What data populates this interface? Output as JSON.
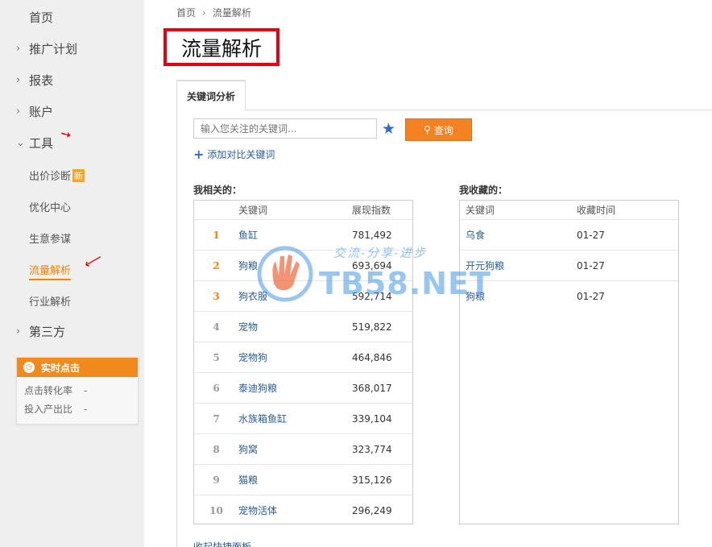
{
  "sidebar": {
    "home": "首页",
    "plan": "推广计划",
    "report": "报表",
    "account": "账户",
    "tools": "工具",
    "tool_items": [
      "出价诊断",
      "优化中心",
      "生意参谋",
      "流量解析",
      "行业解析"
    ],
    "new_badge": "新",
    "third_party": "第三方",
    "realtime": {
      "title": "实时点击",
      "rows": [
        {
          "label": "点击转化率",
          "value": "-"
        },
        {
          "label": "投入产出比",
          "value": "-"
        }
      ]
    }
  },
  "breadcrumb": {
    "home": "首页",
    "current": "流量解析"
  },
  "page_title": "流量解析",
  "tab": "关键词分析",
  "search": {
    "placeholder": "输入您关注的关键词...",
    "button": "查询"
  },
  "add_compare": "添加对比关键词",
  "related": {
    "title": "我相关的：",
    "headers": {
      "keyword": "关键词",
      "index": "展现指数"
    },
    "rows": [
      {
        "rank": "1",
        "keyword": "鱼缸",
        "value": "781,492"
      },
      {
        "rank": "2",
        "keyword": "狗粮",
        "value": "693,694"
      },
      {
        "rank": "3",
        "keyword": "狗衣服",
        "value": "592,714"
      },
      {
        "rank": "4",
        "keyword": "宠物",
        "value": "519,822"
      },
      {
        "rank": "5",
        "keyword": "宠物狗",
        "value": "464,846"
      },
      {
        "rank": "6",
        "keyword": "泰迪狗粮",
        "value": "368,017"
      },
      {
        "rank": "7",
        "keyword": "水族箱鱼缸",
        "value": "339,104"
      },
      {
        "rank": "8",
        "keyword": "狗窝",
        "value": "323,774"
      },
      {
        "rank": "9",
        "keyword": "猫粮",
        "value": "315,126"
      },
      {
        "rank": "10",
        "keyword": "宠物活体",
        "value": "296,249"
      }
    ]
  },
  "favorites": {
    "title": "我收藏的：",
    "headers": {
      "keyword": "关键词",
      "time": "收藏时间"
    },
    "rows": [
      {
        "keyword": "乌食",
        "time": "01-27"
      },
      {
        "keyword": "开元狗粮",
        "time": "01-27"
      },
      {
        "keyword": "狗粮",
        "time": "01-27"
      }
    ]
  },
  "bottom_link": "收起快捷面板",
  "watermark": {
    "text": "TB58.NET",
    "slogan": "交流-分享-进步"
  },
  "colors": {
    "accent": "#f08300",
    "link": "#2b5d9b",
    "title_border": "#e60012",
    "button": "#f58220"
  }
}
